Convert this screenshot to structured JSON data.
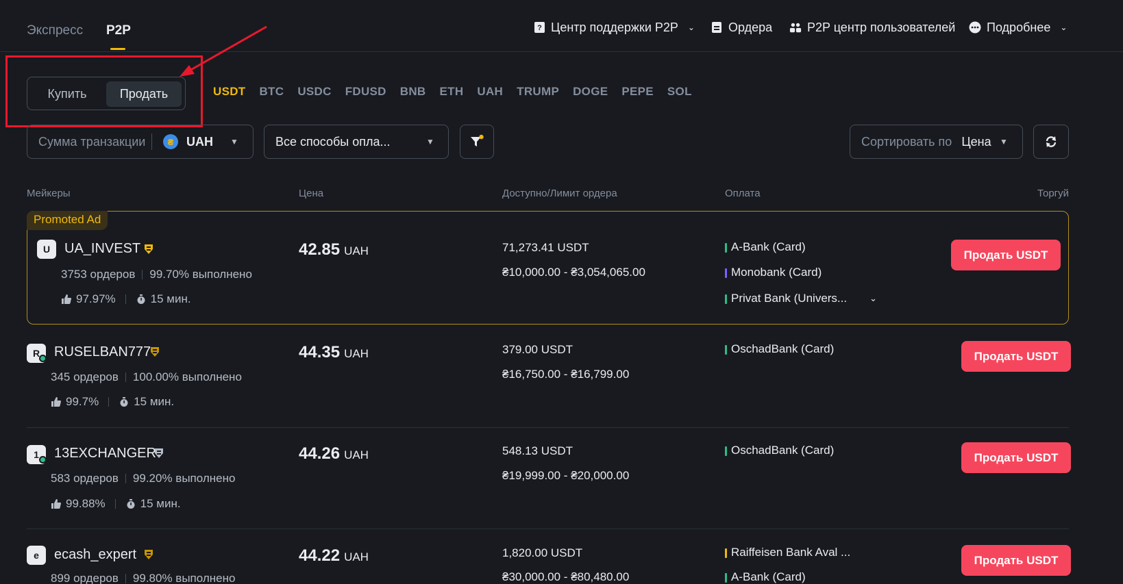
{
  "modes": {
    "express": "Экспресс",
    "p2p": "P2P"
  },
  "top_nav": {
    "support": "Центр поддержки P2P",
    "orders": "Ордера",
    "user_center": "P2P центр пользователей",
    "more": "Подробнее"
  },
  "toggle": {
    "buy": "Купить",
    "sell": "Продать"
  },
  "coins": [
    "USDT",
    "BTC",
    "USDC",
    "FDUSD",
    "BNB",
    "ETH",
    "UAH",
    "TRUMP",
    "DOGE",
    "PEPE",
    "SOL"
  ],
  "filters": {
    "amount_label": "Сумма транзакции",
    "currency": "UAH",
    "payment_methods": "Все способы опла...",
    "sort_label": "Сортировать по",
    "sort_value": "Цена"
  },
  "table_headers": {
    "makers": "Мейкеры",
    "price": "Цена",
    "available": "Доступно/Лимит ордера",
    "payment": "Оплата",
    "trade": "Торгуй"
  },
  "promo_label": "Promoted Ad",
  "rows": [
    {
      "avatar": "U",
      "name": "UA_INVEST",
      "orders": "3753 ордеров",
      "completion": "99.70% выполнено",
      "rating": "97.97%",
      "time": "15 мин.",
      "price": "42.85",
      "price_currency": "UAH",
      "available": "71,273.41 USDT",
      "limit": "₴10,000.00 - ₴3,054,065.00",
      "payments": [
        {
          "name": "A-Bank (Card)",
          "color": "#2EBD85"
        },
        {
          "name": "Monobank (Card)",
          "color": "#7B61FF"
        },
        {
          "name": "Privat Bank (Univers...",
          "color": "#2EBD85"
        }
      ],
      "action": "Продать USDT"
    },
    {
      "avatar": "R",
      "name": "RUSELBAN777",
      "orders": "345 ордеров",
      "completion": "100.00% выполнено",
      "rating": "99.7%",
      "time": "15 мин.",
      "price": "44.35",
      "price_currency": "UAH",
      "available": "379.00 USDT",
      "limit": "₴16,750.00 - ₴16,799.00",
      "payments": [
        {
          "name": "OschadBank (Card)",
          "color": "#2EBD85"
        }
      ],
      "action": "Продать USDT"
    },
    {
      "avatar": "1",
      "name": "13EXCHANGER",
      "orders": "583 ордеров",
      "completion": "99.20% выполнено",
      "rating": "99.88%",
      "time": "15 мин.",
      "price": "44.26",
      "price_currency": "UAH",
      "available": "548.13 USDT",
      "limit": "₴19,999.00 - ₴20,000.00",
      "payments": [
        {
          "name": "OschadBank (Card)",
          "color": "#2EBD85"
        }
      ],
      "action": "Продать USDT"
    },
    {
      "avatar": "e",
      "name": "ecash_expert",
      "orders": "899 ордеров",
      "completion": "99.80% выполнено",
      "price": "44.22",
      "price_currency": "UAH",
      "available": "1,820.00 USDT",
      "limit": "₴30,000.00 - ₴80,480.00",
      "payments": [
        {
          "name": "Raiffeisen Bank Aval ...",
          "color": "#F0B90B"
        },
        {
          "name": "A-Bank (Card)",
          "color": "#2EBD85"
        }
      ],
      "action": "Продать USDT"
    }
  ],
  "colors": {
    "background": "#181A20",
    "accent": "#F0B90B",
    "sell": "#F6465D",
    "annotation": "#E8192C"
  }
}
